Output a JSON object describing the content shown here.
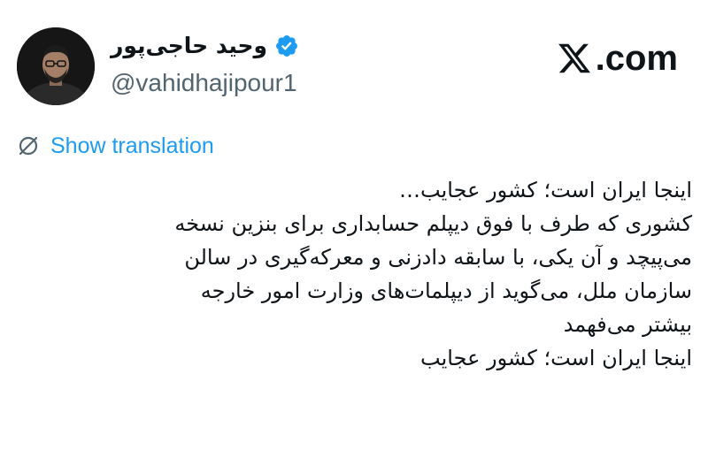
{
  "author": {
    "display_name": "وحید حاجی‌پور",
    "handle": "@vahidhajipour1",
    "verified": true,
    "verified_color": "#1d9bf0"
  },
  "site": {
    "domain_text": ".com",
    "logo_icon": "x-logo-icon"
  },
  "translation": {
    "label": "Show translation",
    "icon": "globe-slash-icon",
    "color": "#1d9bf0"
  },
  "tweet": {
    "lines": [
      "اینجا ایران است؛ کشور عجایب…",
      "کشوری که طرف با فوق دیپلم حسابداری برای بنزین نسخه",
      "می‌پیچد و آن یکی، با سابقه دادزنی و معرکه‌گیری در سالن",
      "سازمان ملل، می‌گوید از دیپلمات‌های وزارت امور خارجه",
      "بیشتر می‌فهمد",
      "اینجا ایران است؛ کشور عجایب"
    ]
  }
}
